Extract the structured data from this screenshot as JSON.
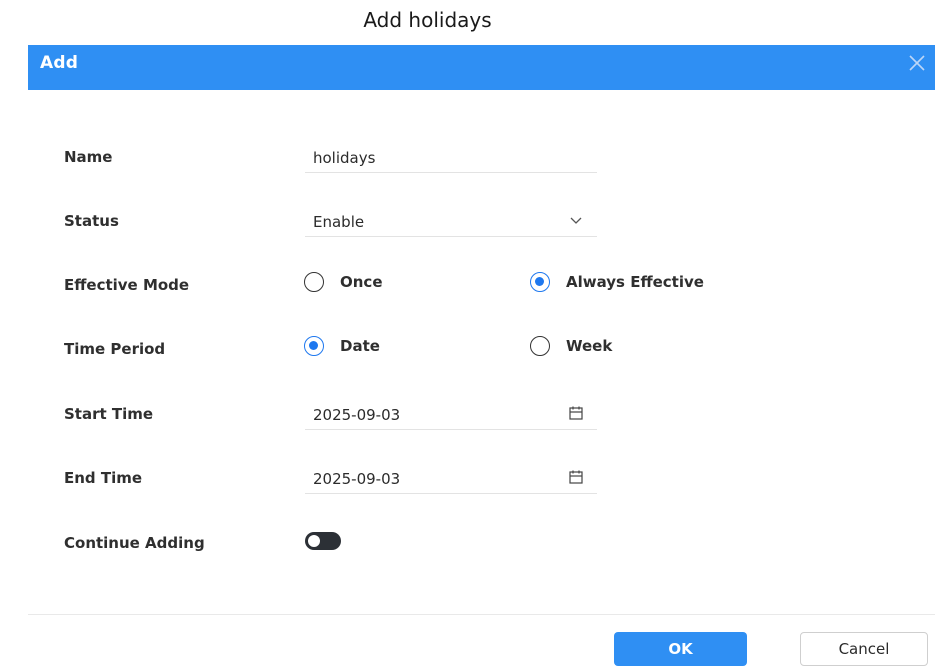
{
  "page": {
    "caption": "Add holidays"
  },
  "dialog": {
    "title": "Add",
    "colors": {
      "header": "#2f8ff3",
      "accent": "#1e78ef"
    },
    "fields": {
      "name": {
        "label": "Name",
        "value": "holidays"
      },
      "status": {
        "label": "Status",
        "value": "Enable",
        "icon": "chevron-down-icon"
      },
      "effective_mode": {
        "label": "Effective Mode",
        "options": [
          "Once",
          "Always Effective"
        ],
        "selected": "Always Effective"
      },
      "time_period": {
        "label": "Time Period",
        "options": [
          "Date",
          "Week"
        ],
        "selected": "Date"
      },
      "start_time": {
        "label": "Start Time",
        "value": "2025-09-03",
        "icon": "calendar-icon"
      },
      "end_time": {
        "label": "End Time",
        "value": "2025-09-03",
        "icon": "calendar-icon"
      },
      "continue_adding": {
        "label": "Continue Adding",
        "enabled": false
      }
    },
    "buttons": {
      "ok": "OK",
      "cancel": "Cancel"
    }
  }
}
